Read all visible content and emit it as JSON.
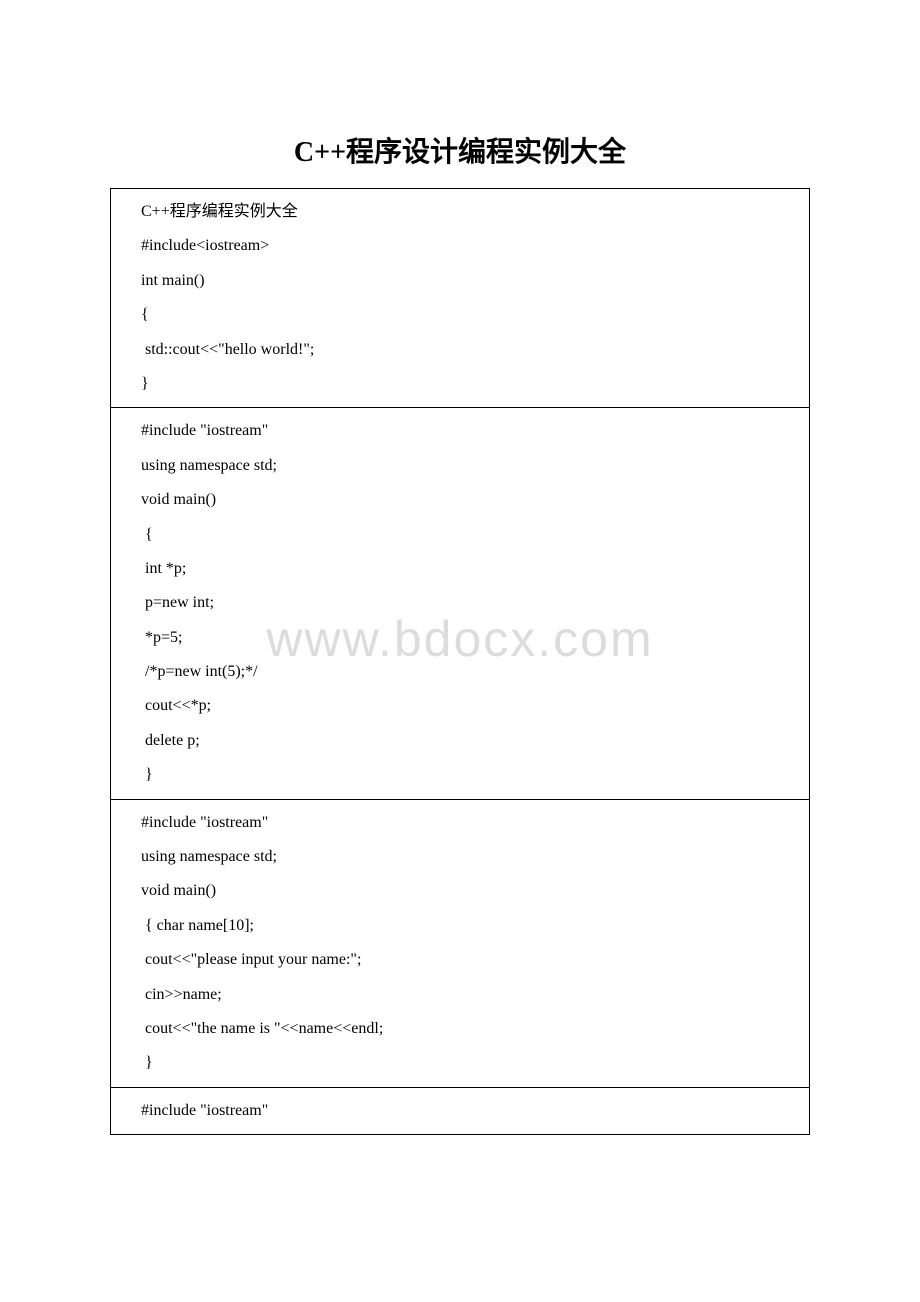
{
  "title": "C++程序设计编程实例大全",
  "watermark": "www.bdocx.com",
  "cells": [
    {
      "lines": [
        "C++程序编程实例大全",
        "#include<iostream>",
        "int main()",
        "{",
        " std::cout<<\"hello world!\";",
        "}"
      ]
    },
    {
      "lines": [
        "#include \"iostream\"",
        "using namespace std;",
        "void main()",
        " {",
        " int *p;",
        " p=new int;",
        " *p=5;",
        " /*p=new int(5);*/",
        " cout<<*p;",
        " delete p;",
        " }"
      ]
    },
    {
      "lines": [
        "#include \"iostream\"",
        "using namespace std;",
        "void main()",
        " { char name[10];",
        " cout<<\"please input your name:\";",
        " cin>>name;",
        " cout<<\"the name is \"<<name<<endl;",
        " }"
      ]
    },
    {
      "lines": [
        "#include \"iostream\""
      ]
    }
  ]
}
